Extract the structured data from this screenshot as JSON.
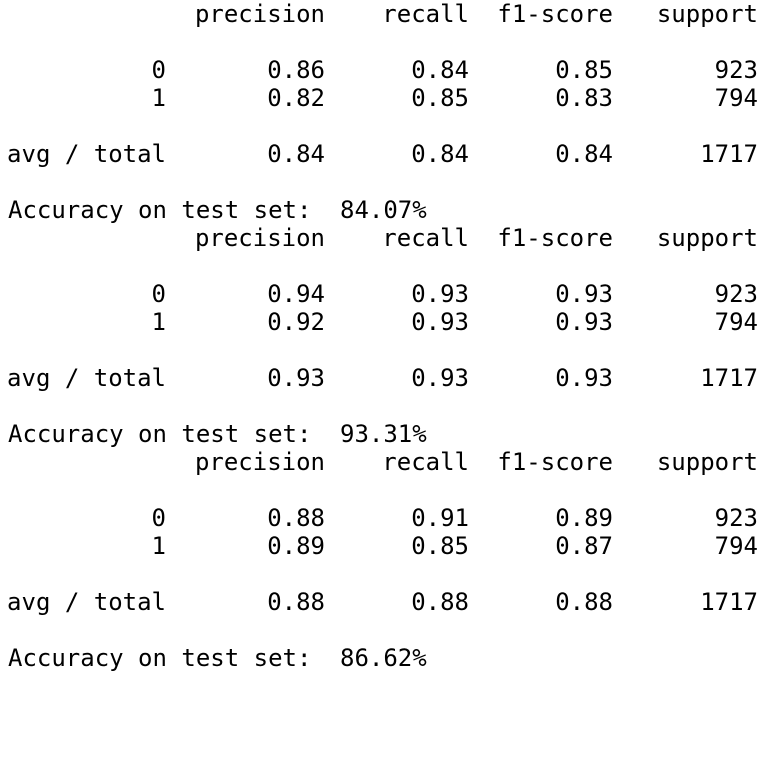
{
  "headers": {
    "precision": "precision",
    "recall": "recall",
    "f1": "f1-score",
    "support": "support"
  },
  "accuracy_label": "Accuracy on test set:",
  "reports": [
    {
      "rows": [
        {
          "label": "0",
          "precision": "0.86",
          "recall": "0.84",
          "f1": "0.85",
          "support": "923"
        },
        {
          "label": "1",
          "precision": "0.82",
          "recall": "0.85",
          "f1": "0.83",
          "support": "794"
        }
      ],
      "total": {
        "label": "avg / total",
        "precision": "0.84",
        "recall": "0.84",
        "f1": "0.84",
        "support": "1717"
      },
      "accuracy": "84.07%"
    },
    {
      "rows": [
        {
          "label": "0",
          "precision": "0.94",
          "recall": "0.93",
          "f1": "0.93",
          "support": "923"
        },
        {
          "label": "1",
          "precision": "0.92",
          "recall": "0.93",
          "f1": "0.93",
          "support": "794"
        }
      ],
      "total": {
        "label": "avg / total",
        "precision": "0.93",
        "recall": "0.93",
        "f1": "0.93",
        "support": "1717"
      },
      "accuracy": "93.31%"
    },
    {
      "rows": [
        {
          "label": "0",
          "precision": "0.88",
          "recall": "0.91",
          "f1": "0.89",
          "support": "923"
        },
        {
          "label": "1",
          "precision": "0.89",
          "recall": "0.85",
          "f1": "0.87",
          "support": "794"
        }
      ],
      "total": {
        "label": "avg / total",
        "precision": "0.88",
        "recall": "0.88",
        "f1": "0.88",
        "support": "1717"
      },
      "accuracy": "86.62%"
    }
  ]
}
